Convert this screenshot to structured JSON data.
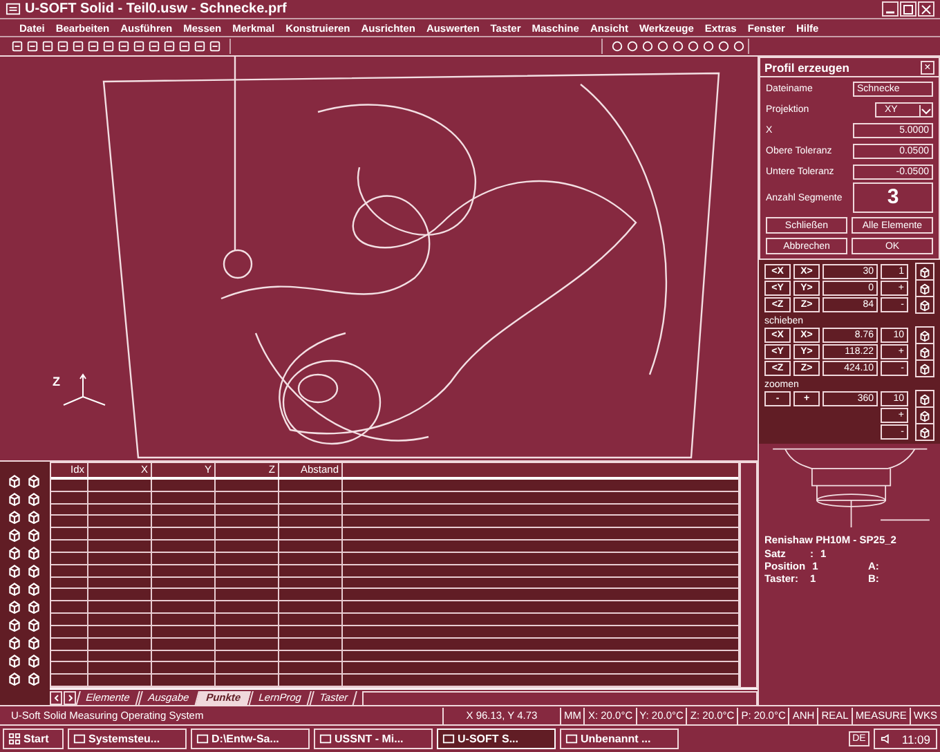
{
  "window": {
    "title": "U-SOFT Solid - Teil0.usw - Schnecke.prf"
  },
  "menu": [
    "Datei",
    "Bearbeiten",
    "Ausführen",
    "Messen",
    "Merkmal",
    "Konstruieren",
    "Ausrichten",
    "Auswerten",
    "Taster",
    "Maschine",
    "Ansicht",
    "Werkzeuge",
    "Extras",
    "Fenster",
    "Hilfe"
  ],
  "viewport": {
    "axis_label": "Z"
  },
  "dialog": {
    "title": "Profil erzeugen",
    "close": "×",
    "fields": [
      {
        "label": "Dateiname",
        "value": "Schnecke",
        "kind": "text"
      },
      {
        "label": "Projektion",
        "value": "XY",
        "kind": "select"
      },
      {
        "label": "X",
        "value": "5.0000",
        "kind": "number"
      },
      {
        "label": "Obere Toleranz",
        "value": "0.0500",
        "kind": "number"
      },
      {
        "label": "Untere Toleranz",
        "value": "-0.0500",
        "kind": "number"
      },
      {
        "label": "Anzahl Segmente",
        "value": "3",
        "kind": "big"
      }
    ],
    "buttons": [
      "Schließen",
      "Alle Elemente",
      "Abbrechen",
      "OK"
    ]
  },
  "transform_groups": [
    {
      "rows": [
        {
          "buttons": [
            "<X",
            "X>"
          ],
          "value": "30",
          "extra": "1"
        },
        {
          "buttons": [
            "<Y",
            "Y>"
          ],
          "value": "0",
          "extra": "+"
        },
        {
          "buttons": [
            "<Z",
            "Z>"
          ],
          "value": "84",
          "extra": "-"
        }
      ]
    },
    {
      "label": "schieben",
      "rows": [
        {
          "buttons": [
            "<X",
            "X>"
          ],
          "value": "8.76",
          "extra": "10"
        },
        {
          "buttons": [
            "<Y",
            "Y>"
          ],
          "value": "118.22",
          "extra": "+"
        },
        {
          "buttons": [
            "<Z",
            "Z>"
          ],
          "value": "424.10",
          "extra": "-"
        }
      ]
    },
    {
      "label": "zoomen",
      "rows": [
        {
          "buttons": [
            "-",
            "+"
          ],
          "value": "360",
          "extra": "10"
        },
        {
          "extra": "+"
        },
        {
          "extra": "-"
        }
      ]
    }
  ],
  "probe": {
    "title": "Renishaw PH10M - SP25_2",
    "lines": [
      {
        "label": "Satz",
        "sep": ":",
        "value": "1"
      },
      {
        "label": "Position",
        "value": "1"
      },
      {
        "label": "Taster:",
        "value": "1"
      }
    ],
    "angles": [
      "A:",
      "B:"
    ]
  },
  "table": {
    "columns": [
      "Idx",
      "X",
      "Y",
      "Z",
      "Abstand"
    ]
  },
  "tabs": [
    {
      "label": "Elemente",
      "selected": false
    },
    {
      "label": "Ausgabe",
      "selected": false
    },
    {
      "label": "Punkte",
      "selected": true
    },
    {
      "label": "LernProg",
      "selected": false
    },
    {
      "label": "Taster",
      "selected": false
    }
  ],
  "status_bar": {
    "message": "U-Soft Solid Measuring Operating System",
    "cells": [
      "X 96.13, Y 4.73",
      "MM",
      "X: 20.0°C",
      "Y: 20.0°C",
      "Z: 20.0°C",
      "P: 20.0°C",
      "ANH",
      "REAL",
      "MEASURE",
      "WKS"
    ]
  },
  "taskbar": {
    "start": "Start",
    "items": [
      {
        "label": "Systemsteu...",
        "selected": false
      },
      {
        "label": "D:\\Entw-Sa...",
        "selected": false
      },
      {
        "label": "USSNT - Mi...",
        "selected": false
      },
      {
        "label": "U-SOFT S...",
        "selected": true
      },
      {
        "label": "Unbenannt ...",
        "selected": false
      }
    ],
    "language": "DE",
    "clock": "11:09"
  }
}
